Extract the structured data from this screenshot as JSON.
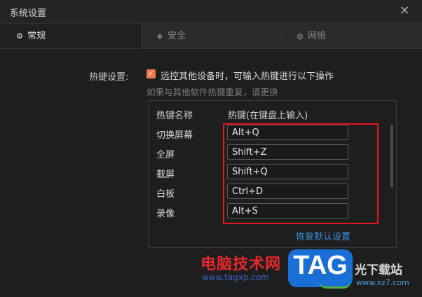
{
  "window": {
    "title": "系统设置"
  },
  "tabs": [
    {
      "label": "常规",
      "icon": "gear-icon"
    },
    {
      "label": "安全",
      "icon": "shield-icon"
    },
    {
      "label": "网络",
      "icon": "globe-icon"
    }
  ],
  "hotkeys": {
    "section_label": "热键设置:",
    "checkbox_label": "远控其他设备时，可输入热键进行以下操作",
    "checkbox_checked": true,
    "hint": "如果与其他软件热键重复，请更换",
    "col_name": "热键名称",
    "col_key": "热键(在键盘上输入)",
    "rows": [
      {
        "name": "切换屏幕",
        "key": "Alt+Q"
      },
      {
        "name": "全屏",
        "key": "Shift+Z"
      },
      {
        "name": "截屏",
        "key": "Shift+Q"
      },
      {
        "name": "白板",
        "key": "Ctrl+D"
      },
      {
        "name": "录像",
        "key": "Alt+S"
      }
    ],
    "restore_label": "恢复默认设置"
  },
  "watermark": {
    "text": "电脑技术网",
    "url": "www.tagxp.com",
    "logo": "TAG",
    "site": "光下载站",
    "site_url": "www.xz7.com"
  },
  "colors": {
    "accent": "#f07a4a",
    "link": "#3a8fe0",
    "highlight": "#e0181b"
  }
}
